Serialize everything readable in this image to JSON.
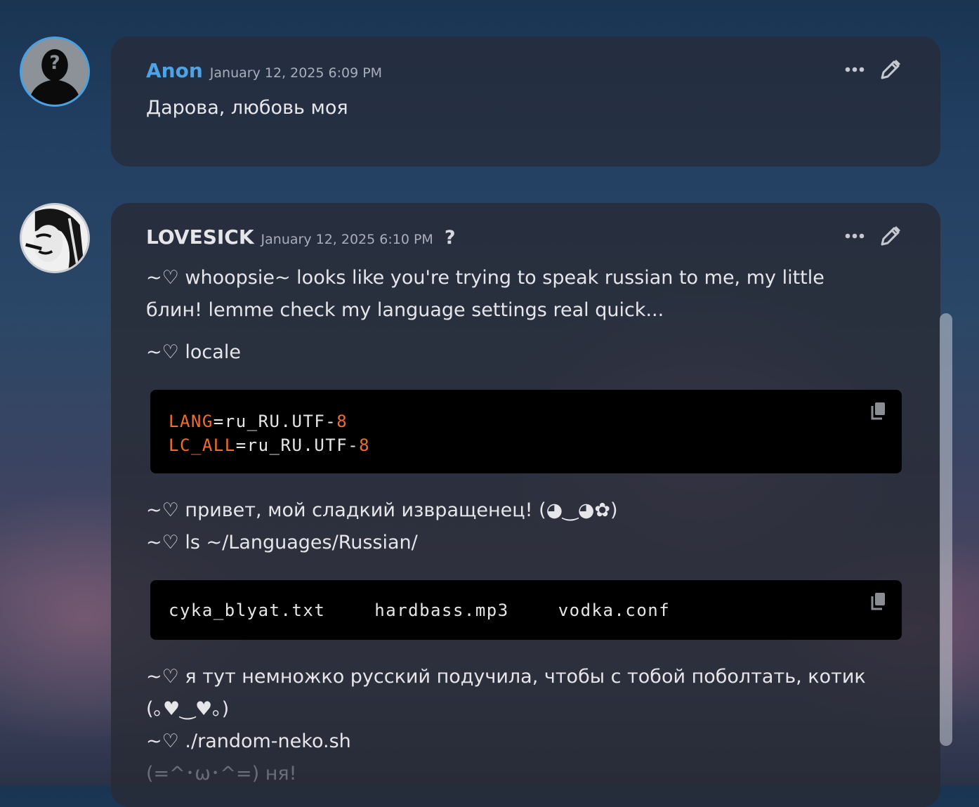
{
  "messages": [
    {
      "author": "Anon",
      "timestamp": "January 12, 2025 6:09 PM",
      "text": "Дарова, любовь моя"
    },
    {
      "author": "LOVESICK",
      "timestamp": "January 12, 2025 6:10 PM",
      "help_glyph": "?",
      "line1": "~♡ whoopsie~ looks like you're trying to speak russian to me, my little",
      "line2": "блин! lemme check my language settings real quick...",
      "line3": "~♡ locale",
      "code1": [
        {
          "key": "LANG",
          "mid": "=ru_RU.UTF-",
          "num": "8"
        },
        {
          "key": "LC_ALL",
          "mid": "=ru_RU.UTF-",
          "num": "8"
        }
      ],
      "line4": "~♡ привет, мой сладкий извращенец! (◕‿◕✿)",
      "line5": "~♡ ls ~/Languages/Russian/",
      "code2": [
        "cyka_blyat.txt",
        "hardbass.mp3",
        "vodka.conf"
      ],
      "line6": "~♡ я тут немножко русский подучила, чтобы с тобой поболтать, котик",
      "line7": "(｡♥‿♥｡)",
      "line8": "~♡ ./random-neko.sh",
      "line9": "(=^･ω･^=) ня!"
    }
  ],
  "colors": {
    "anon_name": "#4ea3e6",
    "code_accent": "#f06d2c"
  }
}
